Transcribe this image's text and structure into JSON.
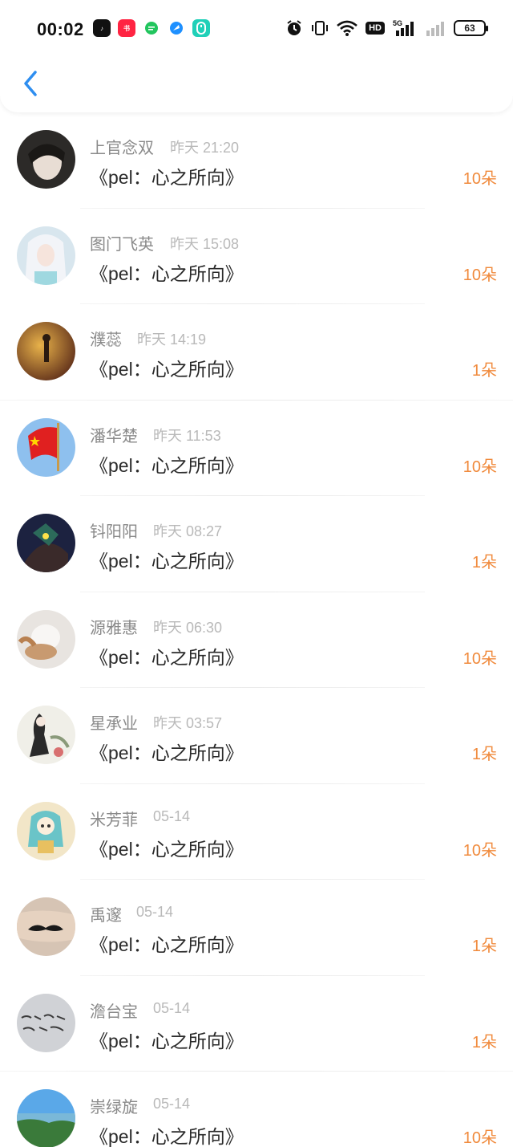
{
  "status_bar": {
    "time": "00:02",
    "network": "5G",
    "battery": "63"
  },
  "colors": {
    "accent_blue": "#2e8ef0",
    "amount_orange": "#f08a3c"
  },
  "rows": [
    {
      "name": "上官念双",
      "time": "昨天 21:20",
      "title": "《pel：心之所向》",
      "amount": "10朵"
    },
    {
      "name": "图门飞英",
      "time": "昨天 15:08",
      "title": "《pel：心之所向》",
      "amount": "10朵"
    },
    {
      "name": "濮蕊",
      "time": "昨天 14:19",
      "title": "《pel：心之所向》",
      "amount": "1朵"
    },
    {
      "name": "潘华楚",
      "time": "昨天 11:53",
      "title": "《pel：心之所向》",
      "amount": "10朵"
    },
    {
      "name": "钭阳阳",
      "time": "昨天 08:27",
      "title": "《pel：心之所向》",
      "amount": "1朵"
    },
    {
      "name": "源雅惠",
      "time": "昨天 06:30",
      "title": "《pel：心之所向》",
      "amount": "10朵"
    },
    {
      "name": "星承业",
      "time": "昨天 03:57",
      "title": "《pel：心之所向》",
      "amount": "1朵"
    },
    {
      "name": "米芳菲",
      "time": "05-14",
      "title": "《pel：心之所向》",
      "amount": "10朵"
    },
    {
      "name": "禹邃",
      "time": "05-14",
      "title": "《pel：心之所向》",
      "amount": "1朵"
    },
    {
      "name": "澹台宝",
      "time": "05-14",
      "title": "《pel：心之所向》",
      "amount": "1朵"
    },
    {
      "name": "崇绿旋",
      "time": "05-14",
      "title": "《pel：心之所向》",
      "amount": "10朵"
    }
  ]
}
